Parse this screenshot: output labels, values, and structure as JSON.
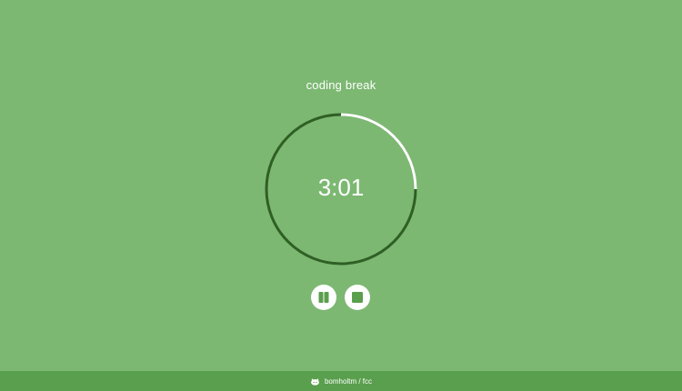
{
  "session": {
    "title": "coding break",
    "time_display": "3:01",
    "remaining_fraction": 0.25
  },
  "controls": {
    "pause_icon": "pause-icon",
    "stop_icon": "stop-icon"
  },
  "footer": {
    "icon": "github-icon",
    "text": "bomholtm / fcc"
  },
  "colors": {
    "background": "#7cb872",
    "footer": "#5a9f4d",
    "ring_track": "#2f5f25",
    "ring_progress": "#ffffff"
  }
}
